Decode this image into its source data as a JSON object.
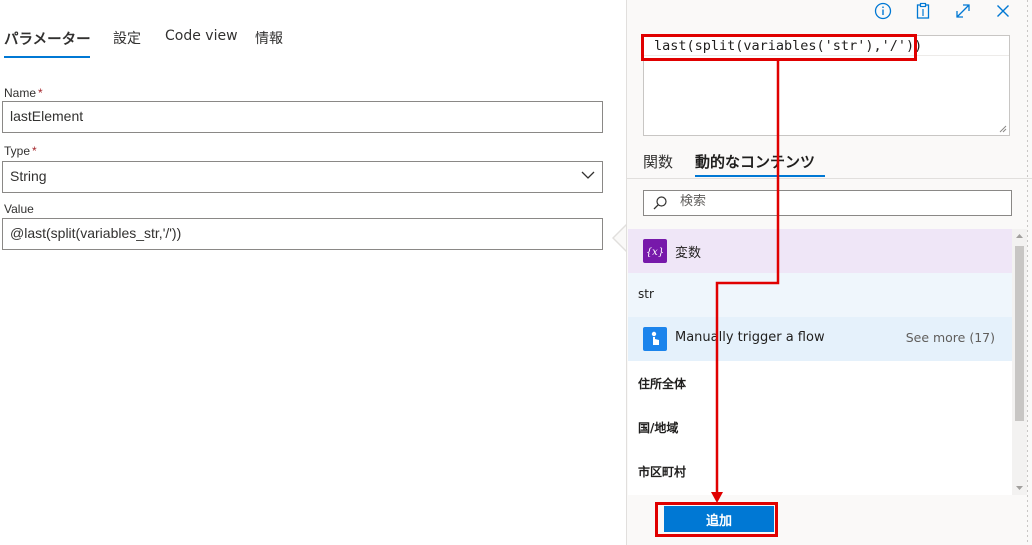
{
  "tabs": [
    {
      "label": "パラメーター",
      "active": true
    },
    {
      "label": "設定",
      "active": false
    },
    {
      "label": "Code view",
      "active": false
    },
    {
      "label": "情報",
      "active": false
    }
  ],
  "fields": {
    "name": {
      "label": "Name",
      "required_mark": "*",
      "value": "lastElement"
    },
    "type": {
      "label": "Type",
      "required_mark": "*",
      "value": "String"
    },
    "value": {
      "label": "Value",
      "value": "@last(split(variables_str,'/'))"
    }
  },
  "panel": {
    "expression": "last(split(variables('str'),'/'))",
    "tabs": [
      {
        "label": "関数",
        "active": false
      },
      {
        "label": "動的なコンテンツ",
        "active": true
      }
    ],
    "search_placeholder": "検索",
    "groups": {
      "variables": {
        "title": "変数",
        "icon": "variable-icon",
        "color": "#7719aa"
      },
      "trigger": {
        "title": "Manually trigger a flow",
        "see_more": "See more (17)",
        "icon": "manual-trigger-icon",
        "color": "#1b84ec"
      }
    },
    "items": {
      "str": "str",
      "trigger_items": [
        "住所全体",
        "国/地域",
        "市区町村"
      ]
    },
    "add_button": "追加"
  },
  "colors": {
    "accent": "#0078d4",
    "annotation": "#e00000"
  }
}
